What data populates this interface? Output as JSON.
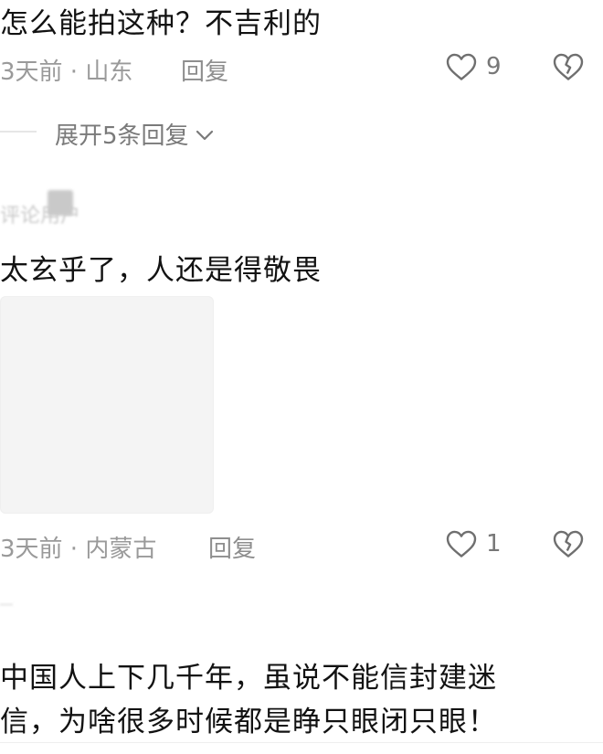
{
  "comment1": {
    "text": "怎么能拍这种？不吉利的",
    "meta": "3天前 · 山东",
    "reply": "回复",
    "likes": "9",
    "expand": "展开5条回复"
  },
  "comment2": {
    "username": "评论用户",
    "text": "太玄乎了，人还是得敬畏",
    "meta": "3天前 · 内蒙古",
    "reply": "回复",
    "likes": "1"
  },
  "comment3": {
    "line1": "中国人上下几千年，虽说不能信封建迷",
    "line2": "信，为啥很多时候都是睁只眼闭只眼！"
  },
  "icons": {
    "like": "heart-outline-icon",
    "dislike": "broken-heart-icon",
    "chevron": "chevron-down-icon"
  }
}
